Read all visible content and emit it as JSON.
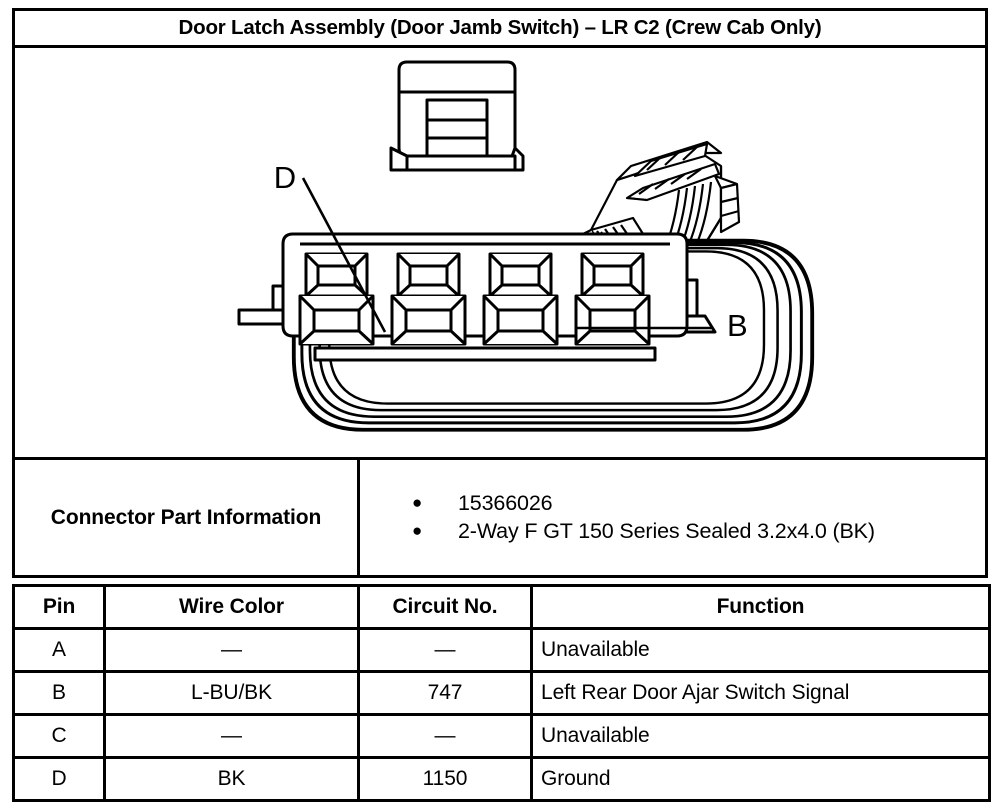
{
  "header": {
    "title": "Door Latch Assembly (Door Jamb Switch) – LR C2 (Crew Cab Only)"
  },
  "illustration": {
    "callouts": [
      {
        "label": "D",
        "description": "leader-line to leftmost terminal cavity"
      },
      {
        "label": "B",
        "description": "leader-line to right side of terminal row"
      }
    ],
    "views": [
      {
        "name": "connector-face-view",
        "description": "front face of sealed 4-cavity connector"
      },
      {
        "name": "connector-isometric-view",
        "description": "small 3D line drawing of connector body"
      }
    ]
  },
  "connector_part_information": {
    "label": "Connector Part Information",
    "items": [
      "15366026",
      "2-Way F GT 150 Series Sealed 3.2x4.0 (BK)"
    ]
  },
  "pin_table": {
    "columns": [
      "Pin",
      "Wire Color",
      "Circuit No.",
      "Function"
    ],
    "rows": [
      {
        "pin": "A",
        "wire_color": "—",
        "circuit_no": "—",
        "function": "Unavailable"
      },
      {
        "pin": "B",
        "wire_color": "L-BU/BK",
        "circuit_no": "747",
        "function": "Left Rear Door Ajar Switch Signal"
      },
      {
        "pin": "C",
        "wire_color": "—",
        "circuit_no": "—",
        "function": "Unavailable"
      },
      {
        "pin": "D",
        "wire_color": "BK",
        "circuit_no": "1150",
        "function": "Ground"
      }
    ]
  },
  "colors": {
    "ink": "#000000",
    "paper": "#ffffff"
  }
}
